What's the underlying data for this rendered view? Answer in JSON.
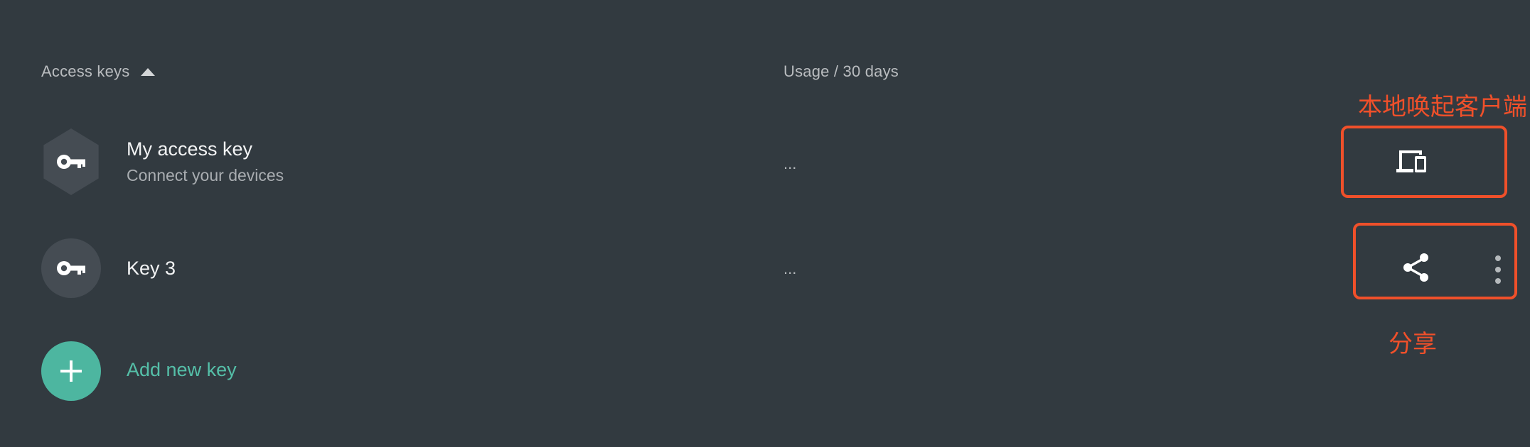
{
  "header": {
    "access_keys_label": "Access keys",
    "usage_label": "Usage / 30 days"
  },
  "keys": [
    {
      "title": "My access key",
      "subtitle": "Connect your devices",
      "usage": "...",
      "icon": "key-icon",
      "shape": "hexagon"
    },
    {
      "title": "Key 3",
      "usage": "...",
      "icon": "key-icon",
      "shape": "circle"
    }
  ],
  "add_key": {
    "label": "Add new key",
    "icon": "plus-icon"
  },
  "annotations": {
    "connect_label": "本地唤起客户端",
    "share_label": "分享"
  },
  "colors": {
    "background": "#323a40",
    "accent": "#4db6a0",
    "annotation": "#f0502a"
  }
}
